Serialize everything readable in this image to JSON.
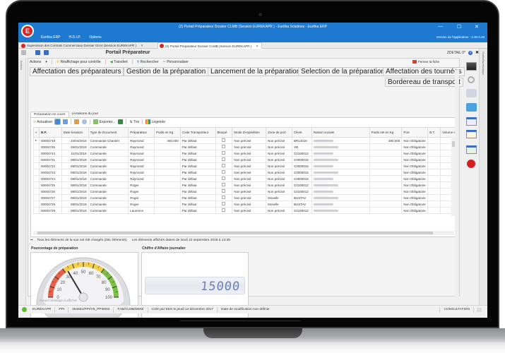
{
  "window": {
    "title": "(2) Portail Préparateur Dossier CLMB (Session EUREKAPR ) - Eurêka Solutions - Eurêka ERP",
    "logo_letter": "E",
    "menu": [
      "Eurêka ERP",
      "H.D.I.P.",
      "Options"
    ],
    "version": "Version de l'application : 2.20.0.48",
    "controls": {
      "minimize": "—",
      "maximize": "☐",
      "close": "✕"
    }
  },
  "doc_tabs": [
    {
      "label": "Supervision des Contrats Commerciaux Dossier 01V4 (Session EUREKAPR )",
      "close": "✕",
      "active": false
    },
    {
      "label": "(2) Portail Préparateur Dossier CLMB (Session EUREKAPR )",
      "close": "✕",
      "active": true
    }
  ],
  "header": {
    "title": "Portail Préparateur",
    "zdetail": "ZDETAIL 0*",
    "help": "?",
    "close": "✖"
  },
  "rails": {
    "left": "Actions",
    "right": "Outils/favoris/apps"
  },
  "actionbar": {
    "actions": "Actions",
    "reaffichage": "Réaffichage pour contrôle",
    "transfert": "Transfert",
    "rechercher": "Rechercher",
    "personnaliser": "Personnaliser",
    "fermer": "Fermer la fiche"
  },
  "big_buttons": [
    "Affectation des préparateurs",
    "Gestion de la préparation",
    "Lancement de la préparation",
    "Selection de la préparation",
    "Affectation des tournées",
    "Bordereau de transport"
  ],
  "subtabs": [
    {
      "label": "Préparation en cours",
      "active": true
    },
    {
      "label": "Livraisons du jour",
      "active": false
    }
  ],
  "grid_toolbar": {
    "actualiser": "Actualiser",
    "exporter": "Exporter...",
    "tris": "Tris",
    "legende": "Légende"
  },
  "grid": {
    "columns": [
      "B.P.",
      "Date livraison",
      "Type de Document",
      "Préparateur",
      "Poids en Kg",
      "Code Transporteur",
      "Bloqué",
      "Mode d'expédition",
      "Zone de port",
      "Client",
      "Raison sociale",
      "Poids net en Kg",
      "Port",
      "B.T.",
      "Volume e"
    ],
    "rows": [
      [
        "00004749",
        "23/04/2018",
        "Commande Chantier",
        "Raymond",
        "450,000",
        "Par défaut",
        "",
        "Non précisé",
        "Non précisé",
        "BR14016",
        "",
        "380,000",
        "Non Obligatoire",
        "",
        ""
      ],
      [
        "00004745",
        "26/01/2018",
        "Commande",
        "Raymond",
        "",
        "Par défaut",
        "",
        "Non précisé",
        "Non précisé",
        "VB",
        "",
        "",
        "Non Obligatoire",
        "",
        ""
      ],
      [
        "00004744",
        "11/01/2018",
        "Commande",
        "Raymond",
        "",
        "Par défaut",
        "",
        "Non précisé",
        "Non précisé",
        "C0150012",
        "",
        "",
        "Non Obligatoire",
        "",
        ""
      ],
      [
        "00004721",
        "08/01/2018",
        "Commande",
        "Raymond",
        "",
        "Par défaut",
        "",
        "Non précisé",
        "Non précisé",
        "C0000015",
        "",
        "",
        "Non Obligatoire",
        "",
        ""
      ],
      [
        "00004722",
        "08/01/2018",
        "Commande",
        "Raymond",
        "",
        "Par défaut",
        "",
        "Non précisé",
        "Non précisé",
        "C0000015",
        "",
        "",
        "Non Obligatoire",
        "",
        ""
      ],
      [
        "00004723",
        "08/01/2018",
        "Commande",
        "Raymond",
        "",
        "Par défaut",
        "",
        "Non précisé",
        "Non précisé",
        "C0000015",
        "",
        "",
        "Non Obligatoire",
        "",
        ""
      ],
      [
        "00004724",
        "08/01/2018",
        "Commande",
        "Raymond",
        "",
        "Par défaut",
        "",
        "Non précisé",
        "Non précisé",
        "C0000015",
        "",
        "",
        "Non Obligatoire",
        "",
        ""
      ],
      [
        "00004725",
        "08/01/2018",
        "Commande",
        "Roger",
        "",
        "Par défaut",
        "",
        "Non précisé",
        "Non précisé",
        "C0150012",
        "",
        "",
        "Non Obligatoire",
        "",
        ""
      ],
      [
        "00004726",
        "08/01/2018",
        "Commande",
        "Roger",
        "",
        "Par défaut",
        "",
        "Non précisé",
        "Non précisé",
        "C0150012",
        "",
        "",
        "Non Obligatoire",
        "",
        ""
      ],
      [
        "00004727",
        "08/01/2018",
        "Commande",
        "Roger",
        "",
        "Par défaut",
        "",
        "Non précisé",
        "Moselle",
        "BUSTAV",
        "",
        "",
        "Non Obligatoire",
        "",
        ""
      ],
      [
        "00004728",
        "08/01/2018",
        "Commande",
        "Roger",
        "",
        "Par défaut",
        "",
        "Non précisé",
        "Moselle",
        "BUSTAV",
        "",
        "",
        "Non Obligatoire",
        "",
        ""
      ],
      [
        "00004729",
        "08/01/2018",
        "Commande",
        "Laurence",
        "",
        "Par défaut",
        "",
        "Non précisé",
        "Non précisé",
        "C0150012",
        "",
        "",
        "Non Obligatoire",
        "",
        ""
      ]
    ]
  },
  "status_line": {
    "loaded": "Tous les éléments de la vue ont été chargés (281 éléments).",
    "dated": "Les éléments affichés datent de lundi 10 septembre 2018 à 13:39."
  },
  "gauge": {
    "title": "Pourcentage de préparation",
    "ticks": [
      "0",
      "10",
      "20",
      "30",
      "40",
      "50",
      "60",
      "70",
      "80",
      "90",
      "100"
    ],
    "value": 33,
    "min": 0,
    "max": 100,
    "colors": {
      "red": "#e8604a",
      "yellow": "#f2cf4a",
      "green": "#7cc043"
    }
  },
  "ca": {
    "title": "Chiffre d'Affaire journalier",
    "value": "15000",
    "digit_color": "#6a80b8"
  },
  "messages": {
    "empty": "Aucun message à afficher"
  },
  "statusbar": {
    "items": [
      "EUREKAPR",
      "PPI",
      "352661/PPI/V5_PPI0002",
      "FAB/CLMB/DEM/",
      "Créé par EES le jeudi 14 décembre 2017",
      "Date de modification non définie"
    ],
    "mode": "CONSULTATION"
  }
}
